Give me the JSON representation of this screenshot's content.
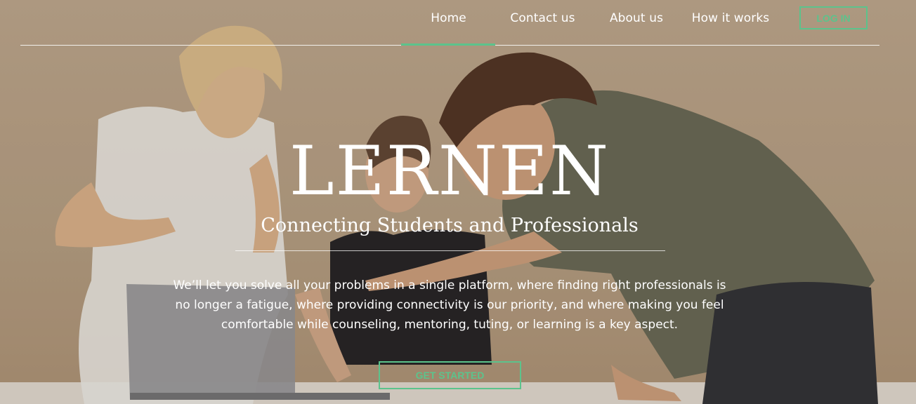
{
  "nav": {
    "items": [
      {
        "label": "Home",
        "active": true
      },
      {
        "label": "Contact us"
      },
      {
        "label": "About us"
      },
      {
        "label": "How it works"
      }
    ],
    "login_label": "LOG IN"
  },
  "hero": {
    "brand": "LERNEN",
    "tagline": "Connecting Students and Professionals",
    "description": "We’ll let you solve all your problems in a single platform, where finding right professionals is no longer a fatigue, where providing connectivity is our priority, and where making you feel comfortable while counseling, mentoring, tuting, or learning is a key aspect.",
    "cta_label": "GET STARTED"
  },
  "colors": {
    "accent": "#5cc38c",
    "background": "#b59f87",
    "text": "#ffffff"
  }
}
